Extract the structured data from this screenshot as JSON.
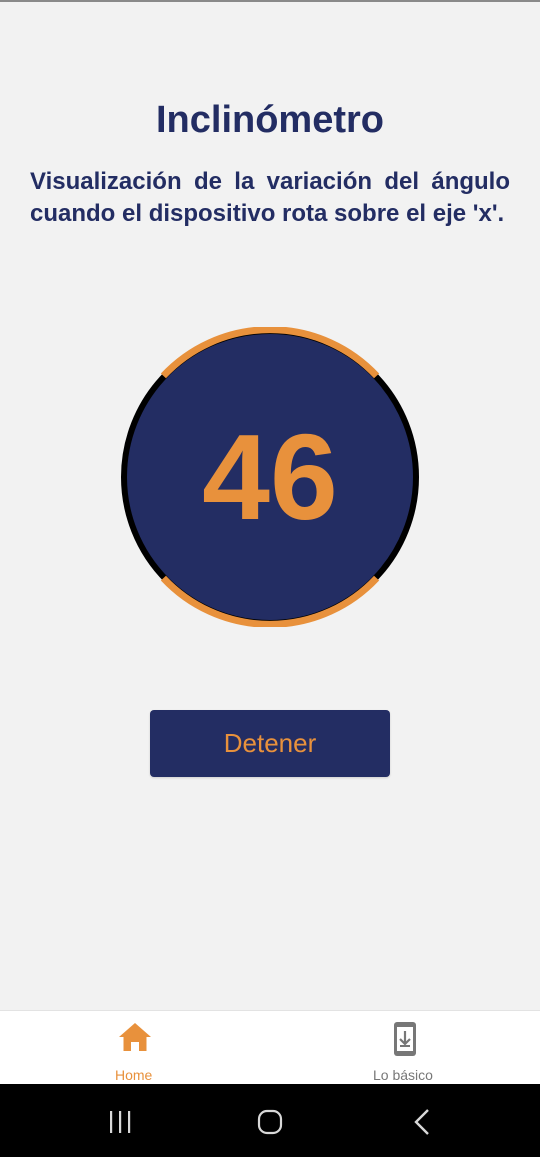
{
  "header": {
    "title": "Inclinómetro",
    "subtitle": "Visualización de la variación del ángulo cuando el dispositivo rota sobre el eje 'x'."
  },
  "gauge": {
    "value": "46",
    "colors": {
      "face": "#232d63",
      "arc": "#e8913c",
      "ring": "#000000",
      "value_text": "#e8913c"
    }
  },
  "actions": {
    "stop_label": "Detener"
  },
  "bottom_nav": {
    "items": [
      {
        "label": "Home",
        "icon": "home-icon",
        "active": true,
        "color": "#e8913c"
      },
      {
        "label": "Lo básico",
        "icon": "phone-download-icon",
        "active": false,
        "color": "#777777"
      }
    ]
  },
  "system_nav": {
    "buttons": [
      "recent-apps-icon",
      "home-circle-icon",
      "back-chevron-icon"
    ]
  },
  "theme": {
    "background": "#f2f2f2",
    "primary": "#232d63",
    "accent": "#e8913c"
  }
}
